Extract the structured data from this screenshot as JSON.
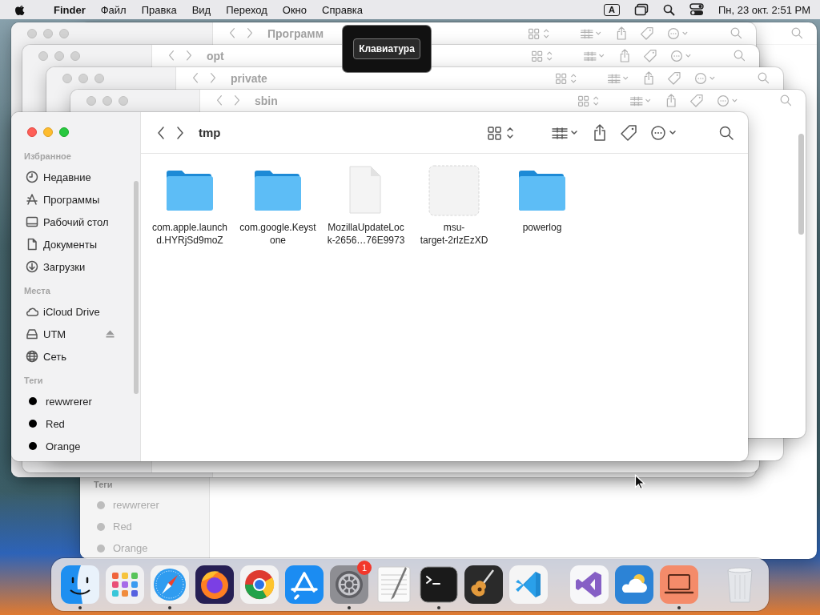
{
  "menu_bar": {
    "menus": [
      {
        "label": "Finder",
        "kind": "app"
      },
      {
        "label": "Файл",
        "kind": "menu"
      },
      {
        "label": "Правка",
        "kind": "menu"
      },
      {
        "label": "Вид",
        "kind": "menu"
      },
      {
        "label": "Переход",
        "kind": "menu"
      },
      {
        "label": "Окно",
        "kind": "menu"
      },
      {
        "label": "Справка",
        "kind": "menu"
      }
    ],
    "input_source": "A",
    "clock": "Пн, 23 окт. 2:51 PM"
  },
  "keyboard_hud": {
    "label": "Клавиатура"
  },
  "background_windows": [
    {
      "kind": "tags",
      "tags_heading": "Теги",
      "tags": [
        "rewwrerer",
        "Red",
        "Orange"
      ]
    },
    {
      "kind": "plain",
      "title": "Программ"
    },
    {
      "kind": "plain",
      "title": "opt"
    },
    {
      "kind": "plain",
      "title": "private"
    },
    {
      "kind": "plain",
      "title": "sbin"
    }
  ],
  "window": {
    "title": "tmp",
    "sidebar": [
      {
        "heading": "Избранное",
        "items": [
          {
            "label": "Недавние",
            "kind": "clock",
            "selected": false
          },
          {
            "label": "Программы",
            "kind": "apps",
            "selected": false
          },
          {
            "label": "Рабочий стол",
            "kind": "desktop",
            "selected": false
          },
          {
            "label": "Документы",
            "kind": "document",
            "selected": false
          },
          {
            "label": "Загрузки",
            "kind": "download",
            "selected": false
          }
        ]
      },
      {
        "heading": "Места",
        "items": [
          {
            "label": "iCloud Drive",
            "kind": "cloud",
            "selected": false,
            "ejectable": false
          },
          {
            "label": "UTM",
            "kind": "drive",
            "selected": false,
            "ejectable": true
          },
          {
            "label": "Сеть",
            "kind": "globe",
            "selected": false,
            "ejectable": false
          }
        ]
      },
      {
        "heading": "Теги",
        "items": [
          {
            "label": "rewwrerer",
            "kind": "tag",
            "selected": false,
            "color": "#000000"
          },
          {
            "label": "Red",
            "kind": "tag",
            "selected": false,
            "color": "#000000"
          },
          {
            "label": "Orange",
            "kind": "tag",
            "selected": false,
            "color": "#000000"
          }
        ]
      }
    ],
    "files": [
      {
        "kind": "folder",
        "lines": [
          "com.apple.launch",
          "d.HYRjSd9moZ"
        ]
      },
      {
        "kind": "folder",
        "lines": [
          "com.google.Keyst",
          "one"
        ]
      },
      {
        "kind": "document",
        "lines": [
          "MozillaUpdateLoc",
          "k-2656…76E9973"
        ]
      },
      {
        "kind": "blank",
        "lines": [
          "msu-",
          "target-2rlzEzXD"
        ]
      },
      {
        "kind": "folder",
        "lines": [
          "powerlog"
        ]
      }
    ]
  },
  "dock": {
    "items": [
      {
        "kind": "finder",
        "running": true
      },
      {
        "kind": "launchpad",
        "running": false
      },
      {
        "kind": "safari",
        "running": true
      },
      {
        "kind": "firefox",
        "running": false
      },
      {
        "kind": "chrome",
        "running": false
      },
      {
        "kind": "appstore",
        "running": false
      },
      {
        "kind": "settings",
        "running": true,
        "badge": "1"
      },
      {
        "kind": "textedit",
        "running": false
      },
      {
        "kind": "terminal",
        "running": true
      },
      {
        "kind": "garageband",
        "running": false
      },
      {
        "kind": "vscode",
        "running": false
      },
      {
        "kind": "separator"
      },
      {
        "kind": "visualstudio",
        "running": false
      },
      {
        "kind": "weather",
        "running": false
      },
      {
        "kind": "laptop",
        "running": true
      },
      {
        "kind": "separator"
      },
      {
        "kind": "trash",
        "running": false
      }
    ]
  }
}
